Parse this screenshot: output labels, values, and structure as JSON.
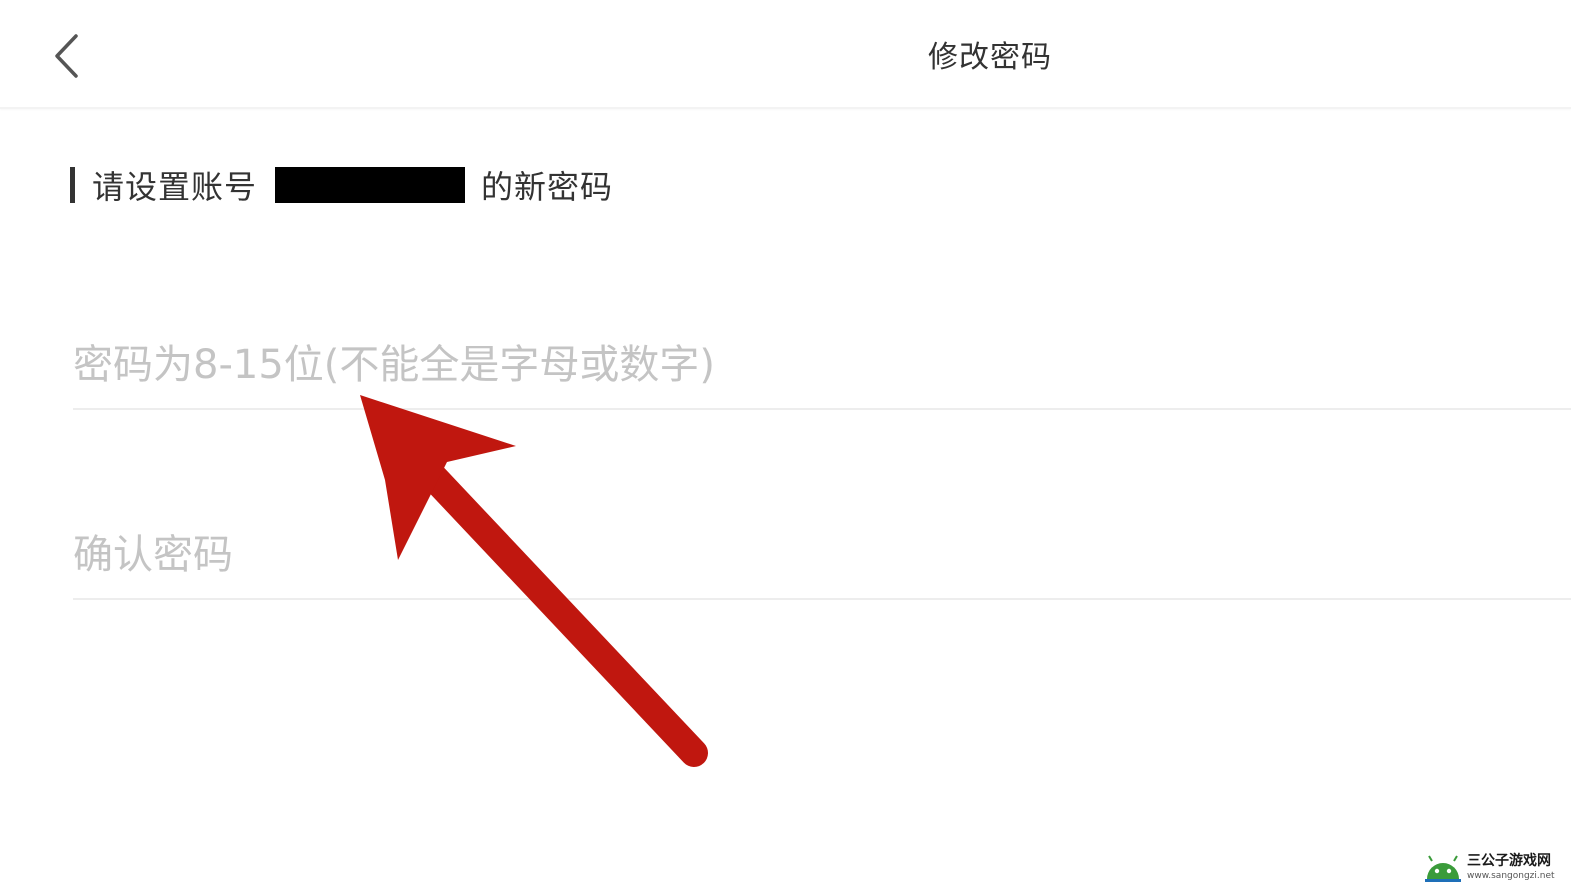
{
  "header": {
    "title": "修改密码",
    "back_icon": "chevron-left-icon"
  },
  "section": {
    "heading_prefix": "请设置账号",
    "heading_suffix": "的新密码"
  },
  "form": {
    "new_password_placeholder": "密码为8-15位(不能全是字母或数字)",
    "confirm_password_placeholder": "确认密码"
  },
  "annotation": {
    "arrow_color": "#c0170f"
  },
  "watermark": {
    "name": "三公子游戏网",
    "url": "www.sangongzi.net"
  }
}
